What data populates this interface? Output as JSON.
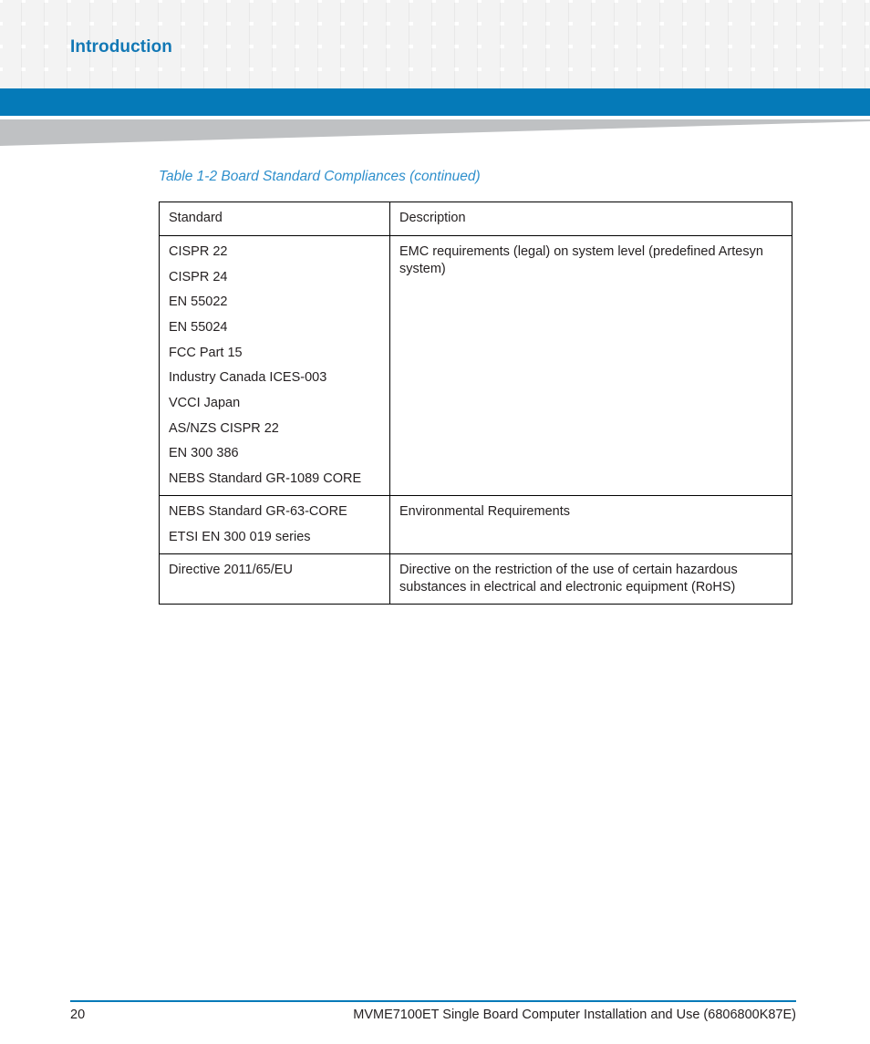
{
  "header": {
    "section_title": "Introduction",
    "accent_color": "#1278b5",
    "banner_color": "#057ab8",
    "swoosh_color": "#bfc1c3",
    "grid_cell_color": "#f3f3f3"
  },
  "main": {
    "table_caption": "Table 1-2 Board Standard Compliances (continued)",
    "caption_color": "#2e8fcc",
    "table": {
      "columns": [
        "Standard",
        "Description"
      ],
      "rows": [
        {
          "standards": [
            "CISPR 22",
            "CISPR 24",
            "EN 55022",
            "EN 55024",
            "FCC Part 15",
            "Industry Canada ICES-003",
            "VCCI Japan",
            "AS/NZS CISPR 22",
            "EN 300 386",
            "NEBS Standard GR-1089 CORE"
          ],
          "description": "EMC requirements (legal) on system level (predefined Artesyn system)"
        },
        {
          "standards": [
            "NEBS Standard GR-63-CORE",
            "ETSI EN 300 019 series"
          ],
          "description": "Environmental Requirements"
        },
        {
          "standards": [
            "Directive 2011/65/EU"
          ],
          "description": "Directive on the restriction of the use of certain hazardous substances in electrical and electronic equipment (RoHS)"
        }
      ]
    }
  },
  "footer": {
    "page_number": "20",
    "document_title": "MVME7100ET Single Board Computer Installation and Use (6806800K87E)",
    "rule_color": "#057ab8"
  }
}
